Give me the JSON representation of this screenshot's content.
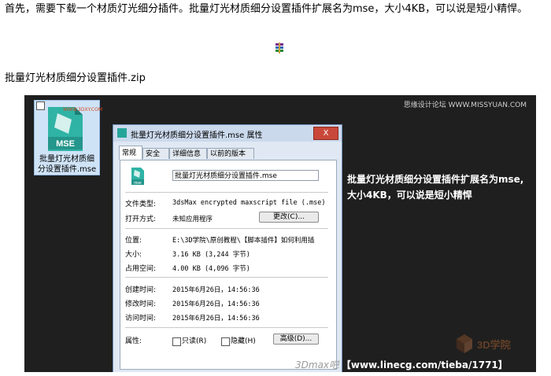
{
  "article": {
    "intro": "首先，需要下载一个材质灯光细分插件。批量灯光材质细分设置插件扩展名为mse，大小4KB，可以说是短小精悍。",
    "zip_link": "批量灯光材质细分设置插件.zip"
  },
  "screenshot": {
    "watermark_top": "思缘设计论坛 WWW.MISSYUAN.COM",
    "file_icon": {
      "badge": "MSE",
      "site_mark": "WWW.3DXY.COM",
      "label_line1": "批量灯光材质细",
      "label_line2": "分设置插件.mse"
    },
    "side_text_line1": "批量灯光材质细分设置插件扩展名为mse,",
    "side_text_line2": "大小4KB，可以说是短小精悍",
    "bottom_prefix": "3Dmax吧",
    "bottom_url": "【www.linecg.com/tieba/1771】",
    "logo_text": "3D学院"
  },
  "dialog": {
    "title": "批量灯光材质细分设置插件.mse 属性",
    "close": "X",
    "tabs": [
      "常规",
      "安全",
      "详细信息",
      "以前的版本"
    ],
    "icon_caption": "mse",
    "file_name": "批量灯光材质细分设置插件.mse",
    "labels": {
      "type": "文件类型:",
      "open_with": "打开方式:",
      "location": "位置:",
      "size": "大小:",
      "size_on_disk": "占用空间:",
      "created": "创建时间:",
      "modified": "修改时间:",
      "accessed": "访问时间:",
      "attributes": "属性:"
    },
    "values": {
      "type": "3dsMax encrypted maxscript file (.mse)",
      "open_with": "未知应用程序",
      "location": "E:\\3D学院\\原创教程\\【脚本插件】如何利用插",
      "size": "3.16 KB (3,244 字节)",
      "size_on_disk": "4.00 KB (4,096 字节)",
      "created": "2015年6月26日，14:56:36",
      "modified": "2015年6月26日，14:56:36",
      "accessed": "2015年6月26日，14:56:36"
    },
    "buttons": {
      "change": "更改(C)...",
      "advanced": "高级(D)..."
    },
    "checkboxes": {
      "readonly": "只读(R)",
      "hidden": "隐藏(H)"
    }
  },
  "colors": {
    "screenshot_bg": "#1f1f1f",
    "accent_teal": "#25a59a",
    "close_red": "#c9483a"
  }
}
